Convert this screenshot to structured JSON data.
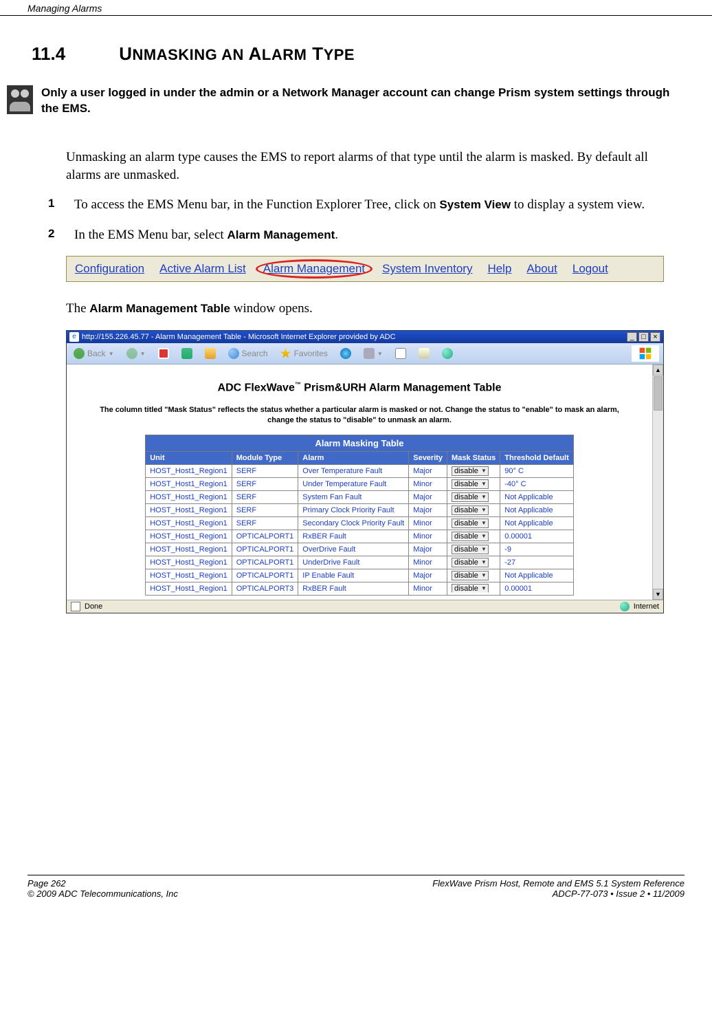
{
  "header": {
    "chapter_title": "Managing Alarms"
  },
  "section": {
    "number": "11.4",
    "title_html": "UNMASKING AN ALARM TYPE"
  },
  "note_text": "Only a user logged in under the admin or a Network Manager account can change Prism system settings through the EMS.",
  "paragraph": "Unmasking an alarm type causes the EMS to report alarms of that type until the alarm is masked. By default all alarms are unmasked.",
  "step1": {
    "pre": "To access the EMS Menu bar, in the Function Explorer Tree, click on ",
    "bold": "System View",
    "post": " to display a system view."
  },
  "step2": {
    "pre": "In the EMS Menu bar, select ",
    "bold": "Alarm Management",
    "post": "."
  },
  "menubar": {
    "items": [
      "Configuration",
      "Active Alarm List",
      "Alarm Management",
      "System Inventory",
      "Help",
      "About",
      "Logout"
    ],
    "circled_index": 2
  },
  "line_after_menubar": {
    "pre": "The ",
    "bold": "Alarm Management Table",
    "post": " window opens."
  },
  "ie": {
    "title": "http://155.226.45.77 - Alarm Management Table - Microsoft Internet Explorer provided by ADC",
    "toolbar": {
      "back": "Back",
      "search": "Search",
      "favorites": "Favorites"
    },
    "page_title": "ADC FlexWave™ Prism&URH Alarm Management Table",
    "page_note": "The column titled \"Mask Status\" reflects the status whether a particular alarm is masked or not. Change the status to \"enable\" to mask an alarm, change the status to \"disable\" to unmask an alarm.",
    "table_title": "Alarm Masking Table",
    "columns": [
      "Unit",
      "Module Type",
      "Alarm",
      "Severity",
      "Mask Status",
      "Threshold Default"
    ],
    "mask_value": "disable",
    "rows": [
      {
        "unit": "HOST_Host1_Region1",
        "module": "SERF",
        "alarm": "Over Temperature Fault",
        "sev": "Major",
        "thr": "90° C"
      },
      {
        "unit": "HOST_Host1_Region1",
        "module": "SERF",
        "alarm": "Under Temperature Fault",
        "sev": "Minor",
        "thr": "-40° C"
      },
      {
        "unit": "HOST_Host1_Region1",
        "module": "SERF",
        "alarm": "System Fan Fault",
        "sev": "Major",
        "thr": "Not Applicable"
      },
      {
        "unit": "HOST_Host1_Region1",
        "module": "SERF",
        "alarm": "Primary Clock Priority Fault",
        "sev": "Major",
        "thr": "Not Applicable"
      },
      {
        "unit": "HOST_Host1_Region1",
        "module": "SERF",
        "alarm": "Secondary Clock Priority Fault",
        "sev": "Minor",
        "thr": "Not Applicable"
      },
      {
        "unit": "HOST_Host1_Region1",
        "module": "OPTICALPORT1",
        "alarm": "RxBER Fault",
        "sev": "Minor",
        "thr": "0.00001"
      },
      {
        "unit": "HOST_Host1_Region1",
        "module": "OPTICALPORT1",
        "alarm": "OverDrive Fault",
        "sev": "Major",
        "thr": "-9"
      },
      {
        "unit": "HOST_Host1_Region1",
        "module": "OPTICALPORT1",
        "alarm": "UnderDrive Fault",
        "sev": "Minor",
        "thr": "-27"
      },
      {
        "unit": "HOST_Host1_Region1",
        "module": "OPTICALPORT1",
        "alarm": "IP Enable Fault",
        "sev": "Major",
        "thr": "Not Applicable"
      },
      {
        "unit": "HOST_Host1_Region1",
        "module": "OPTICALPORT3",
        "alarm": "RxBER Fault",
        "sev": "Minor",
        "thr": "0.00001"
      }
    ],
    "status_done": "Done",
    "status_zone": "Internet"
  },
  "footer": {
    "page": "Page 262",
    "copyright": "© 2009 ADC Telecommunications, Inc",
    "product": "FlexWave Prism Host, Remote and EMS 5.1 System Reference",
    "docid": "ADCP-77-073  •  Issue 2  •  11/2009"
  }
}
